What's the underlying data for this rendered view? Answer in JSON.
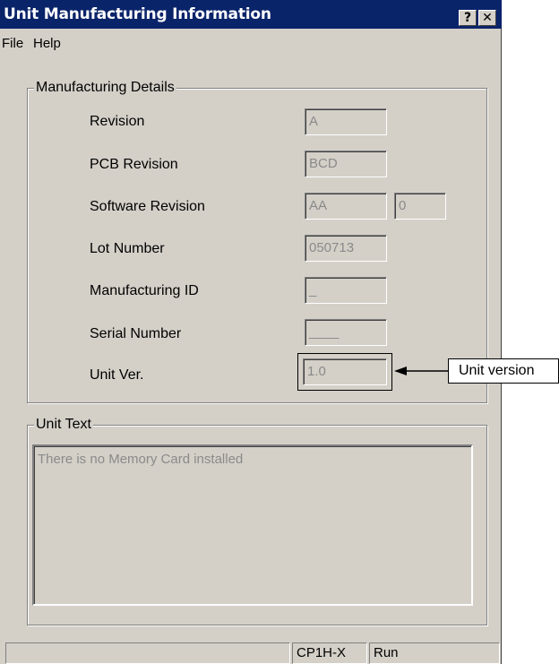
{
  "window": {
    "title": "Unit Manufacturing Information",
    "help_button": "?",
    "close_button": "✕"
  },
  "menu": [
    "File",
    "Help"
  ],
  "manufacturing": {
    "group_label": "Manufacturing Details",
    "revision_label": "Revision",
    "revision_value": "A",
    "pcb_label": "PCB Revision",
    "pcb_value": "BCD",
    "software_label": "Software Revision",
    "software_value": "AA",
    "software_value2": "0",
    "lot_label": "Lot Number",
    "lot_value": "050713",
    "mfg_id_label": "Manufacturing ID",
    "mfg_id_value": "_",
    "serial_label": "Serial Number",
    "serial_value": "____",
    "unit_ver_label": "Unit Ver.",
    "unit_ver_value": "1.0"
  },
  "unit_text": {
    "group_label": "Unit Text",
    "content": "There is no Memory Card installed"
  },
  "statusbar": {
    "model": "CP1H-X",
    "mode": "Run"
  },
  "annotation": {
    "callout": "Unit version"
  }
}
